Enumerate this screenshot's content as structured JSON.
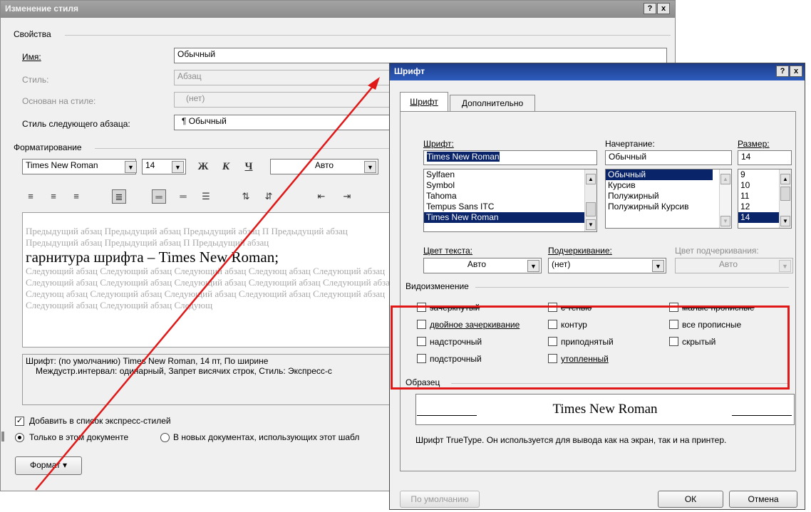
{
  "back_dialog": {
    "title": "Изменение стиля",
    "help_btn": "?",
    "close_btn": "x",
    "properties_group": "Свойства",
    "name_label": "Имя:",
    "name_value": "Обычный",
    "style_label": "Стиль:",
    "style_value": "Абзац",
    "based_on_label": "Основан на стиле:",
    "based_on_value": "(нет)",
    "next_style_label": "Стиль следующего абзаца:",
    "next_style_value": "¶ Обычный",
    "formatting_group": "Форматирование",
    "font_combo": "Times New Roman",
    "size_combo": "14",
    "bold": "Ж",
    "italic": "К",
    "underline": "Ч",
    "color_combo": "Авто",
    "preview_prev": "Предыдущий абзац Предыдущий абзац Предыдущий абзац П Предыдущий абзац Предыдущий абзац Предыдущий абзац П Предыдущий абзац",
    "preview_main": "гарнитура шрифта – Times New Roman;",
    "preview_next": "Следующий абзац Следующий абзац Следующий абзац Следующ абзац Следующий абзац Следующий абзац Следующий абзац Следующий абзац Следующий абзац Следующий абзац Следующ абзац Следующий абзац Следующий абзац Следующий абзац Следующий абзац Следующий абзац Следующий абзац Следующ",
    "description_line1": "Шрифт: (по умолчанию) Times New Roman, 14 пт, По ширине",
    "description_line2": "Междустр.интервал:  одинарный, Запрет висячих строк, Стиль: Экспресс-с",
    "add_quick_styles": "Добавить в список экспресс-стилей",
    "only_this_doc": "Только в этом документе",
    "new_docs": "В новых документах, использующих этот шабл",
    "format_btn": "Формат ▾"
  },
  "font_dialog": {
    "title": "Шрифт",
    "help_btn": "?",
    "close_btn": "x",
    "tabs": [
      "Шрифт",
      "Дополнительно"
    ],
    "font_label": "Шрифт:",
    "font_value": "Times New Roman",
    "font_list": [
      "Sylfaen",
      "Symbol",
      "Tahoma",
      "Tempus Sans ITC",
      "Times New Roman"
    ],
    "style_label": "Начертание:",
    "style_value": "Обычный",
    "style_list": [
      "Обычный",
      "Курсив",
      "Полужирный",
      "Полужирный Курсив"
    ],
    "size_label": "Размер:",
    "size_value": "14",
    "size_list": [
      "9",
      "10",
      "11",
      "12",
      "14"
    ],
    "text_color_label": "Цвет текста:",
    "text_color_value": "Авто",
    "underline_label": "Подчеркивание:",
    "underline_value": "(нет)",
    "underline_color_label": "Цвет подчеркивания:",
    "underline_color_value": "Авто",
    "effects_group": "Видоизменение",
    "effects": {
      "strikethrough": "зачеркнутый",
      "double_strike": "двойное зачеркивание",
      "superscript": "надстрочный",
      "subscript": "подстрочный",
      "shadow": "с тенью",
      "outline": "контур",
      "emboss": "приподнятый",
      "engrave": "утопленный",
      "small_caps": "малые прописные",
      "all_caps": "все прописные",
      "hidden": "скрытый"
    },
    "sample_group": "Образец",
    "sample_text": "Times New Roman",
    "sample_note": "Шрифт TrueType. Он используется для вывода как на экран, так и на принтер.",
    "default_btn": "По умолчанию",
    "ok_btn": "ОК",
    "cancel_btn": "Отмена"
  },
  "colors": {
    "highlight_box": "#e01818",
    "arrow": "#e01818",
    "selection": "#0a246a"
  }
}
